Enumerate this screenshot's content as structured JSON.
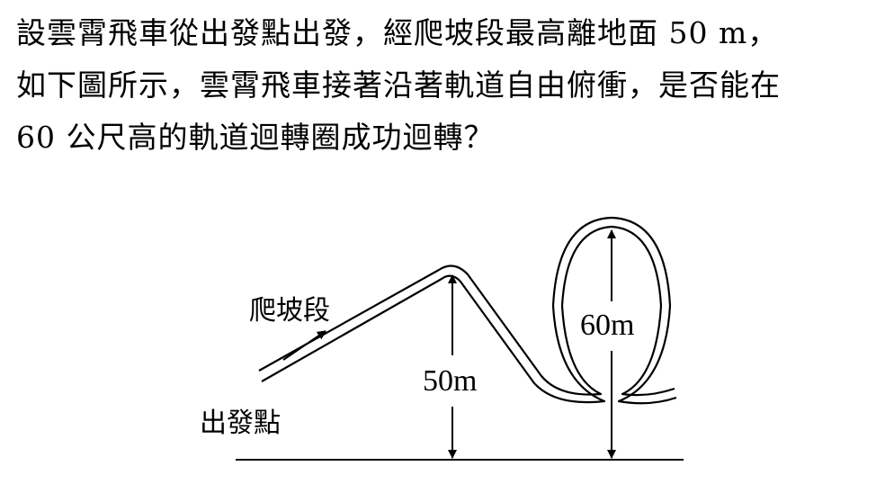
{
  "question": {
    "line1": "設雲霄飛車從出發點出發，經爬坡段最高離地面 50 m，",
    "line2": "如下圖所示，雲霄飛車接著沿著軌道自由俯衝，是否能在",
    "line3": "60 公尺高的軌道迴轉圈成功迴轉？"
  },
  "figure": {
    "climb_label": "爬坡段",
    "start_label": "出發點",
    "peak_height_label": "50m",
    "loop_height_label": "60m"
  }
}
